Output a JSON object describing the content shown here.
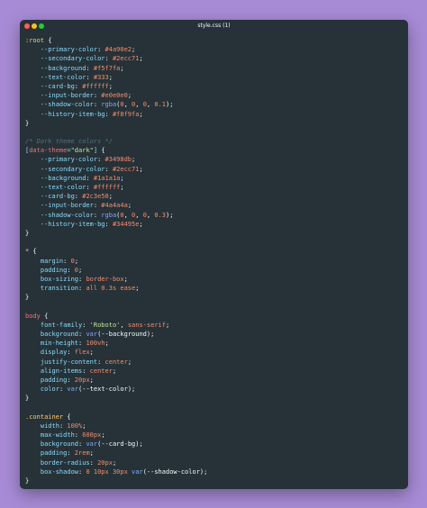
{
  "window": {
    "title": "style.css (1)",
    "controls": {
      "close_color": "#ff5f56",
      "minimize_color": "#ffbd2e",
      "maximize_color": "#27c93f"
    }
  },
  "code": [
    [
      {
        "t": ":root",
        "c": "sel"
      },
      {
        "t": " {",
        "c": "brace"
      }
    ],
    [
      {
        "t": "    --primary-color",
        "c": "prop"
      },
      {
        "t": ": ",
        "c": "brace"
      },
      {
        "t": "#4a90e2",
        "c": "val"
      },
      {
        "t": ";",
        "c": "brace"
      }
    ],
    [
      {
        "t": "    --secondary-color",
        "c": "prop"
      },
      {
        "t": ": ",
        "c": "brace"
      },
      {
        "t": "#2ecc71",
        "c": "val"
      },
      {
        "t": ";",
        "c": "brace"
      }
    ],
    [
      {
        "t": "    --background",
        "c": "prop"
      },
      {
        "t": ": ",
        "c": "brace"
      },
      {
        "t": "#f5f7fa",
        "c": "val"
      },
      {
        "t": ";",
        "c": "brace"
      }
    ],
    [
      {
        "t": "    --text-color",
        "c": "prop"
      },
      {
        "t": ": ",
        "c": "brace"
      },
      {
        "t": "#333",
        "c": "val"
      },
      {
        "t": ";",
        "c": "brace"
      }
    ],
    [
      {
        "t": "    --card-bg",
        "c": "prop"
      },
      {
        "t": ": ",
        "c": "brace"
      },
      {
        "t": "#ffffff",
        "c": "val"
      },
      {
        "t": ";",
        "c": "brace"
      }
    ],
    [
      {
        "t": "    --input-border",
        "c": "prop"
      },
      {
        "t": ": ",
        "c": "brace"
      },
      {
        "t": "#e0e0e0",
        "c": "val"
      },
      {
        "t": ";",
        "c": "brace"
      }
    ],
    [
      {
        "t": "    --shadow-color",
        "c": "prop"
      },
      {
        "t": ": ",
        "c": "brace"
      },
      {
        "t": "rgba",
        "c": "fn"
      },
      {
        "t": "(",
        "c": "brace"
      },
      {
        "t": "0",
        "c": "val"
      },
      {
        "t": ", ",
        "c": "brace"
      },
      {
        "t": "0",
        "c": "val"
      },
      {
        "t": ", ",
        "c": "brace"
      },
      {
        "t": "0",
        "c": "val"
      },
      {
        "t": ", ",
        "c": "brace"
      },
      {
        "t": "0.1",
        "c": "val"
      },
      {
        "t": ");",
        "c": "brace"
      }
    ],
    [
      {
        "t": "    --history-item-bg",
        "c": "prop"
      },
      {
        "t": ": ",
        "c": "brace"
      },
      {
        "t": "#f8f9fa",
        "c": "val"
      },
      {
        "t": ";",
        "c": "brace"
      }
    ],
    [
      {
        "t": "}",
        "c": "brace"
      }
    ],
    [
      {
        "t": "",
        "c": "brace"
      }
    ],
    [
      {
        "t": "/* Dark theme colors */",
        "c": "cmt"
      }
    ],
    [
      {
        "t": "[",
        "c": "punc"
      },
      {
        "t": "data-theme",
        "c": "tag"
      },
      {
        "t": "=",
        "c": "punc"
      },
      {
        "t": "\"dark\"",
        "c": "str"
      },
      {
        "t": "]",
        "c": "punc"
      },
      {
        "t": " {",
        "c": "brace"
      }
    ],
    [
      {
        "t": "    --primary-color",
        "c": "prop"
      },
      {
        "t": ": ",
        "c": "brace"
      },
      {
        "t": "#3498db",
        "c": "val"
      },
      {
        "t": ";",
        "c": "brace"
      }
    ],
    [
      {
        "t": "    --secondary-color",
        "c": "prop"
      },
      {
        "t": ": ",
        "c": "brace"
      },
      {
        "t": "#2ecc71",
        "c": "val"
      },
      {
        "t": ";",
        "c": "brace"
      }
    ],
    [
      {
        "t": "    --background",
        "c": "prop"
      },
      {
        "t": ": ",
        "c": "brace"
      },
      {
        "t": "#1a1a1a",
        "c": "val"
      },
      {
        "t": ";",
        "c": "brace"
      }
    ],
    [
      {
        "t": "    --text-color",
        "c": "prop"
      },
      {
        "t": ": ",
        "c": "brace"
      },
      {
        "t": "#ffffff",
        "c": "val"
      },
      {
        "t": ";",
        "c": "brace"
      }
    ],
    [
      {
        "t": "    --card-bg",
        "c": "prop"
      },
      {
        "t": ": ",
        "c": "brace"
      },
      {
        "t": "#2c3e50",
        "c": "val"
      },
      {
        "t": ";",
        "c": "brace"
      }
    ],
    [
      {
        "t": "    --input-border",
        "c": "prop"
      },
      {
        "t": ": ",
        "c": "brace"
      },
      {
        "t": "#4a4a4a",
        "c": "val"
      },
      {
        "t": ";",
        "c": "brace"
      }
    ],
    [
      {
        "t": "    --shadow-color",
        "c": "prop"
      },
      {
        "t": ": ",
        "c": "brace"
      },
      {
        "t": "rgba",
        "c": "fn"
      },
      {
        "t": "(",
        "c": "brace"
      },
      {
        "t": "0",
        "c": "val"
      },
      {
        "t": ", ",
        "c": "brace"
      },
      {
        "t": "0",
        "c": "val"
      },
      {
        "t": ", ",
        "c": "brace"
      },
      {
        "t": "0",
        "c": "val"
      },
      {
        "t": ", ",
        "c": "brace"
      },
      {
        "t": "0.3",
        "c": "val"
      },
      {
        "t": ");",
        "c": "brace"
      }
    ],
    [
      {
        "t": "    --history-item-bg",
        "c": "prop"
      },
      {
        "t": ": ",
        "c": "brace"
      },
      {
        "t": "#34495e",
        "c": "val"
      },
      {
        "t": ";",
        "c": "brace"
      }
    ],
    [
      {
        "t": "}",
        "c": "brace"
      }
    ],
    [
      {
        "t": "",
        "c": "brace"
      }
    ],
    [
      {
        "t": "*",
        "c": "sel"
      },
      {
        "t": " {",
        "c": "brace"
      }
    ],
    [
      {
        "t": "    margin",
        "c": "prop"
      },
      {
        "t": ": ",
        "c": "brace"
      },
      {
        "t": "0",
        "c": "val"
      },
      {
        "t": ";",
        "c": "brace"
      }
    ],
    [
      {
        "t": "    padding",
        "c": "prop"
      },
      {
        "t": ": ",
        "c": "brace"
      },
      {
        "t": "0",
        "c": "val"
      },
      {
        "t": ";",
        "c": "brace"
      }
    ],
    [
      {
        "t": "    box-sizing",
        "c": "prop"
      },
      {
        "t": ": ",
        "c": "brace"
      },
      {
        "t": "border-box",
        "c": "val"
      },
      {
        "t": ";",
        "c": "brace"
      }
    ],
    [
      {
        "t": "    transition",
        "c": "prop"
      },
      {
        "t": ": ",
        "c": "brace"
      },
      {
        "t": "all 0.3s ease",
        "c": "val"
      },
      {
        "t": ";",
        "c": "brace"
      }
    ],
    [
      {
        "t": "}",
        "c": "brace"
      }
    ],
    [
      {
        "t": "",
        "c": "brace"
      }
    ],
    [
      {
        "t": "body",
        "c": "tag"
      },
      {
        "t": " {",
        "c": "brace"
      }
    ],
    [
      {
        "t": "    font-family",
        "c": "prop"
      },
      {
        "t": ": ",
        "c": "brace"
      },
      {
        "t": "'Roboto'",
        "c": "str"
      },
      {
        "t": ", ",
        "c": "brace"
      },
      {
        "t": "sans-serif",
        "c": "val"
      },
      {
        "t": ";",
        "c": "brace"
      }
    ],
    [
      {
        "t": "    background",
        "c": "prop"
      },
      {
        "t": ": ",
        "c": "brace"
      },
      {
        "t": "var",
        "c": "fn"
      },
      {
        "t": "(--background);",
        "c": "brace"
      }
    ],
    [
      {
        "t": "    min-height",
        "c": "prop"
      },
      {
        "t": ": ",
        "c": "brace"
      },
      {
        "t": "100vh",
        "c": "val"
      },
      {
        "t": ";",
        "c": "brace"
      }
    ],
    [
      {
        "t": "    display",
        "c": "prop"
      },
      {
        "t": ": ",
        "c": "brace"
      },
      {
        "t": "flex",
        "c": "val"
      },
      {
        "t": ";",
        "c": "brace"
      }
    ],
    [
      {
        "t": "    justify-content",
        "c": "prop"
      },
      {
        "t": ": ",
        "c": "brace"
      },
      {
        "t": "center",
        "c": "val"
      },
      {
        "t": ";",
        "c": "brace"
      }
    ],
    [
      {
        "t": "    align-items",
        "c": "prop"
      },
      {
        "t": ": ",
        "c": "brace"
      },
      {
        "t": "center",
        "c": "val"
      },
      {
        "t": ";",
        "c": "brace"
      }
    ],
    [
      {
        "t": "    padding",
        "c": "prop"
      },
      {
        "t": ": ",
        "c": "brace"
      },
      {
        "t": "20px",
        "c": "val"
      },
      {
        "t": ";",
        "c": "brace"
      }
    ],
    [
      {
        "t": "    color",
        "c": "prop"
      },
      {
        "t": ": ",
        "c": "brace"
      },
      {
        "t": "var",
        "c": "fn"
      },
      {
        "t": "(--text-color);",
        "c": "brace"
      }
    ],
    [
      {
        "t": "}",
        "c": "brace"
      }
    ],
    [
      {
        "t": "",
        "c": "brace"
      }
    ],
    [
      {
        "t": ".container",
        "c": "sel"
      },
      {
        "t": " {",
        "c": "brace"
      }
    ],
    [
      {
        "t": "    width",
        "c": "prop"
      },
      {
        "t": ": ",
        "c": "brace"
      },
      {
        "t": "100%",
        "c": "val"
      },
      {
        "t": ";",
        "c": "brace"
      }
    ],
    [
      {
        "t": "    max-width",
        "c": "prop"
      },
      {
        "t": ": ",
        "c": "brace"
      },
      {
        "t": "600px",
        "c": "val"
      },
      {
        "t": ";",
        "c": "brace"
      }
    ],
    [
      {
        "t": "    background",
        "c": "prop"
      },
      {
        "t": ": ",
        "c": "brace"
      },
      {
        "t": "var",
        "c": "fn"
      },
      {
        "t": "(--card-bg);",
        "c": "brace"
      }
    ],
    [
      {
        "t": "    padding",
        "c": "prop"
      },
      {
        "t": ": ",
        "c": "brace"
      },
      {
        "t": "2rem",
        "c": "val"
      },
      {
        "t": ";",
        "c": "brace"
      }
    ],
    [
      {
        "t": "    border-radius",
        "c": "prop"
      },
      {
        "t": ": ",
        "c": "brace"
      },
      {
        "t": "20px",
        "c": "val"
      },
      {
        "t": ";",
        "c": "brace"
      }
    ],
    [
      {
        "t": "    box-shadow",
        "c": "prop"
      },
      {
        "t": ": ",
        "c": "brace"
      },
      {
        "t": "0 10px 30px ",
        "c": "val"
      },
      {
        "t": "var",
        "c": "fn"
      },
      {
        "t": "(--shadow-color);",
        "c": "brace"
      }
    ],
    [
      {
        "t": "}",
        "c": "brace"
      }
    ]
  ]
}
